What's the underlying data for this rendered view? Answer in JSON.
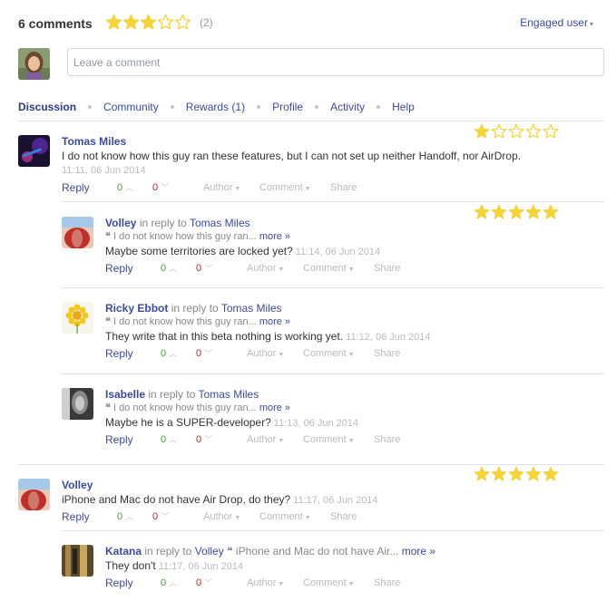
{
  "header": {
    "count_label": "6 comments",
    "rating_stars": 3,
    "rating_count": "(2)",
    "engaged_label": "Engaged user"
  },
  "compose": {
    "placeholder": "Leave a comment"
  },
  "nav": [
    "Discussion",
    "Community",
    "Rewards (1)",
    "Profile",
    "Activity",
    "Help"
  ],
  "actions": {
    "reply": "Reply",
    "author": "Author",
    "comment": "Comment",
    "share": "Share"
  },
  "in_reply_to": "in reply to",
  "more": "more »",
  "colors": {
    "link": "#3b4b9c",
    "star": "#f5d33b",
    "up": "#4a9a3a",
    "down": "#b02a2a"
  },
  "comments": [
    {
      "author": "Tomas Miles",
      "text": "I do not know how this guy ran these features, but I can not set up neither Handoff, nor AirDrop.",
      "time": "11:11, 06 Jun 2014",
      "up": "0",
      "down": "0",
      "stars": 1
    },
    {
      "author": "Volley",
      "reply_to": "Tomas Miles",
      "quote": "I do not know how this guy ran...",
      "text": "Maybe some territories are locked yet?",
      "time": "11:14, 06 Jun 2014",
      "up": "0",
      "down": "0",
      "stars": 5
    },
    {
      "author": "Ricky Ebbot",
      "reply_to": "Tomas Miles",
      "quote": "I do not know how this guy ran...",
      "text": "They write that in this beta nothing is working yet.",
      "time": "11:12, 06 Jun 2014",
      "up": "0",
      "down": "0"
    },
    {
      "author": "Isabelle",
      "reply_to": "Tomas Miles",
      "quote": "I do not know how this guy ran...",
      "text": "Maybe he is a SUPER-developer?",
      "time": "11:13, 06 Jun 2014",
      "up": "0",
      "down": "0"
    },
    {
      "author": "Volley",
      "text": "iPhone and Mac do not have Air Drop, do they?",
      "time": "11:17, 06 Jun 2014",
      "up": "0",
      "down": "0",
      "stars": 5
    },
    {
      "author": "Katana",
      "reply_to": "Volley",
      "quote": "iPhone and Mac do not have Air...",
      "text": "They don't",
      "time": "11:17, 06 Jun 2014",
      "up": "0",
      "down": "0"
    }
  ]
}
